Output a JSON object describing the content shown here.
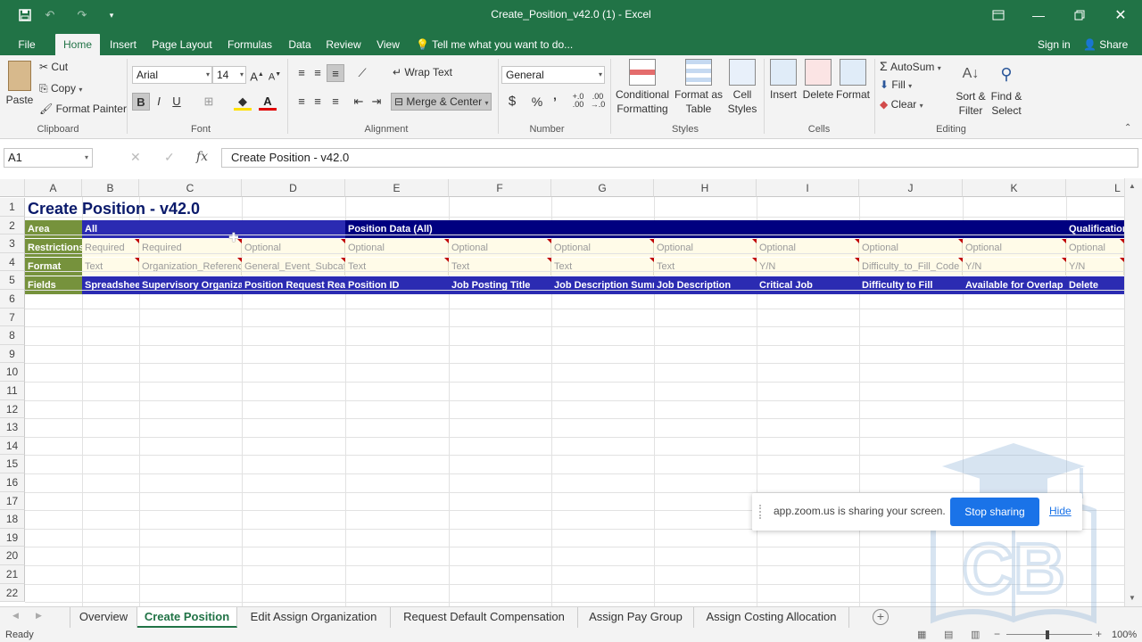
{
  "titlebar": {
    "title": "Create_Position_v42.0 (1) - Excel"
  },
  "menu": {
    "tabs": [
      "File",
      "Home",
      "Insert",
      "Page Layout",
      "Formulas",
      "Data",
      "Review",
      "View"
    ],
    "tell_me": "Tell me what you want to do...",
    "signin": "Sign in",
    "share": "Share"
  },
  "ribbon": {
    "clipboard": {
      "paste": "Paste",
      "cut": "Cut",
      "copy": "Copy",
      "format_painter": "Format Painter",
      "label": "Clipboard"
    },
    "font": {
      "name": "Arial",
      "size": "14",
      "label": "Font",
      "bold": "B",
      "italic": "I",
      "underline": "U"
    },
    "alignment": {
      "wrap": "Wrap Text",
      "merge": "Merge & Center",
      "label": "Alignment"
    },
    "number": {
      "format": "General",
      "currency": "$",
      "percent": "%",
      "comma": "’",
      "label": "Number"
    },
    "styles": {
      "conditional": "Conditional Formatting",
      "format_table": "Format as Table",
      "cell_styles": "Cell Styles",
      "label": "Styles"
    },
    "cells": {
      "insert": "Insert",
      "delete": "Delete",
      "format": "Format",
      "label": "Cells"
    },
    "editing": {
      "autosum": "AutoSum",
      "fill": "Fill",
      "clear": "Clear",
      "sort": "Sort & Filter",
      "find": "Find & Select",
      "label": "Editing"
    }
  },
  "formula": {
    "namebox": "A1",
    "content": "Create Position - v42.0"
  },
  "columns": [
    "A",
    "B",
    "C",
    "D",
    "E",
    "F",
    "G",
    "H",
    "I",
    "J",
    "K",
    "L"
  ],
  "rows": [
    "1",
    "2",
    "3",
    "4",
    "5",
    "6",
    "7",
    "8",
    "9",
    "10",
    "11",
    "12",
    "13",
    "14",
    "15",
    "16",
    "17",
    "18",
    "19",
    "20",
    "21",
    "22"
  ],
  "sheet": {
    "title": "Create Position - v42.0",
    "row2": {
      "area": "Area",
      "all": "All",
      "position_data": "Position Data (All)",
      "qualification": "Qualification"
    },
    "row3": {
      "label": "Restrictions",
      "values": [
        "Required",
        "Required",
        "Optional",
        "Optional",
        "Optional",
        "Optional",
        "Optional",
        "Optional",
        "Optional",
        "Optional",
        "Optional"
      ]
    },
    "row4": {
      "label": "Format",
      "values": [
        "Text",
        "Organization_Reference",
        "General_Event_Subcategory",
        "Text",
        "Text",
        "Text",
        "Text",
        "Y/N",
        "Difficulty_to_Fill_Code",
        "Y/N",
        "Y/N"
      ]
    },
    "row5": {
      "label": "Fields",
      "values": [
        "Spreadsheet",
        "Supervisory Organization",
        "Position Request Reason",
        "Position ID",
        "Job Posting Title",
        "Job Description Summary",
        "Job Description",
        "Critical Job",
        "Difficulty to Fill",
        "Available for Overlap",
        "Delete"
      ]
    }
  },
  "sheet_tabs": [
    "Overview",
    "Create Position",
    "Edit Assign Organization",
    "Request Default Compensation",
    "Assign Pay Group",
    "Assign Costing Allocation"
  ],
  "status": {
    "ready": "Ready",
    "zoom": "100%"
  },
  "zoom_share": {
    "message": "app.zoom.us is sharing your screen.",
    "stop": "Stop sharing",
    "hide": "Hide"
  },
  "watermark": {
    "text": "CB"
  },
  "colors": {
    "excel_green": "#217346",
    "area_green": "#76923c",
    "navy": "#000080",
    "fields_blue": "#2b2bb2"
  }
}
